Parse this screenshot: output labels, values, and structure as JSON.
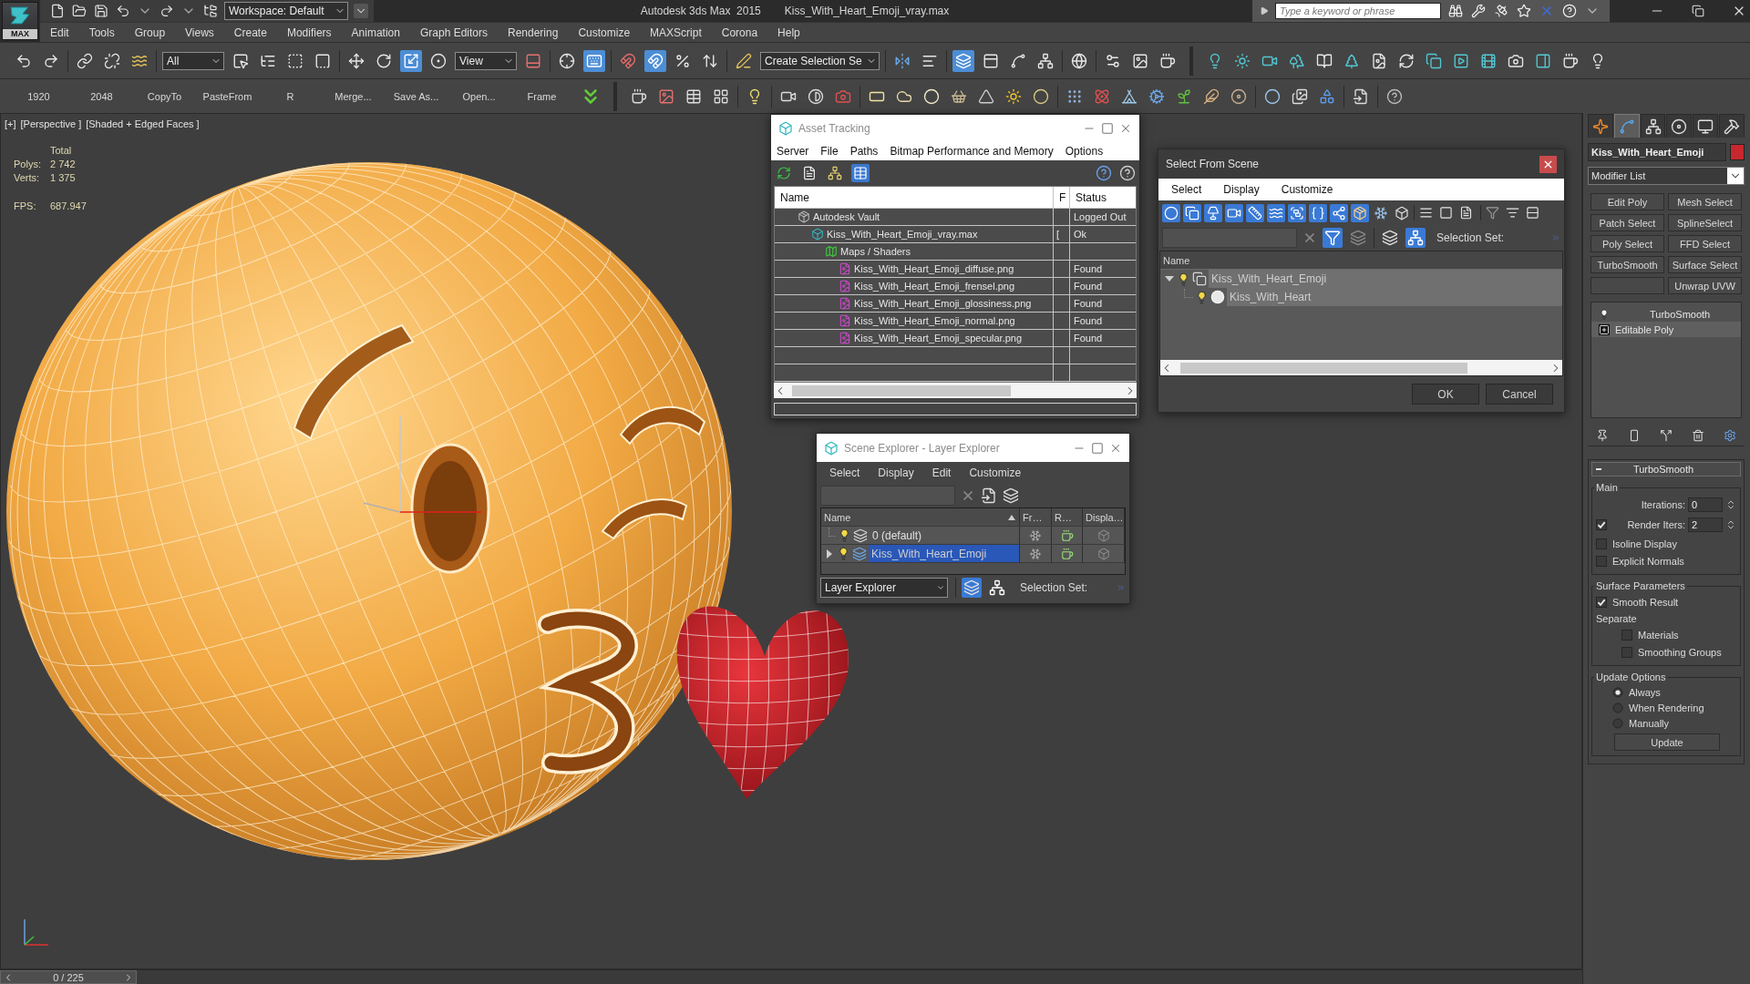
{
  "title_bar": {
    "app_button": "MAX",
    "workspace": "Workspace: Default",
    "app_name": "Autodesk 3ds Max  2015",
    "file_name": "Kiss_With_Heart_Emoji_vray.max",
    "search": {
      "placeholder": "Type a keyword or phrase"
    }
  },
  "menu_bar": [
    "Edit",
    "Tools",
    "Group",
    "Views",
    "Create",
    "Modifiers",
    "Animation",
    "Graph Editors",
    "Rendering",
    "Customize",
    "MAXScript",
    "Corona",
    "Help"
  ],
  "main_toolbar": {
    "groups": [
      [
        {
          "kind": "undo",
          "active": false
        },
        {
          "kind": "redo",
          "active": false
        }
      ],
      [
        {
          "kind": "link",
          "active": false
        },
        {
          "kind": "unlink",
          "active": false
        },
        {
          "kind": "bind",
          "active": false
        }
      ],
      [
        {
          "kind": "dropdown",
          "value": "All"
        },
        {
          "kind": "select",
          "active": false
        },
        {
          "kind": "select-by-name",
          "active": false
        },
        {
          "kind": "rect-region",
          "active": false
        },
        {
          "kind": "window-crossing",
          "active": false
        }
      ],
      [
        {
          "kind": "move",
          "active": false
        },
        {
          "kind": "rotate",
          "active": false
        },
        {
          "kind": "scale",
          "active": true
        },
        {
          "kind": "manipulate",
          "active": false
        },
        {
          "kind": "dropdown",
          "value": "View"
        },
        {
          "kind": "pivot",
          "active": false
        }
      ],
      [
        {
          "kind": "crosshair",
          "active": false
        },
        {
          "kind": "keyboard",
          "active": true
        }
      ],
      [
        {
          "kind": "snap",
          "active": false
        },
        {
          "kind": "angle-snap",
          "active": true
        },
        {
          "kind": "percent-snap",
          "active": false
        },
        {
          "kind": "spinner-snap",
          "active": false
        }
      ],
      [
        {
          "kind": "named-sel-edit",
          "active": false
        },
        {
          "kind": "dropdown",
          "value": "Create Selection Se"
        }
      ],
      [
        {
          "kind": "mirror",
          "active": false
        },
        {
          "kind": "align",
          "active": false
        }
      ],
      [
        {
          "kind": "layer-explorer",
          "active": true
        },
        {
          "kind": "ribbon",
          "active": false
        },
        {
          "kind": "curve-editor",
          "active": false
        },
        {
          "kind": "schematic",
          "active": false
        }
      ],
      [
        {
          "kind": "material-editor",
          "active": false
        }
      ],
      [
        {
          "kind": "render-setup",
          "active": false
        },
        {
          "kind": "render-frame",
          "active": false
        },
        {
          "kind": "render",
          "active": false
        }
      ]
    ]
  },
  "script_buttons": [
    "1920",
    "2048",
    "CopyTo",
    "PasteFrom",
    "R",
    "Merge...",
    "Save As...",
    "Open...",
    "Frame"
  ],
  "viewport": {
    "labels": [
      "[+]",
      "[Perspective ]",
      "[Shaded + Edged Faces ]"
    ],
    "stats": {
      "heading": "Total",
      "rows": [
        {
          "label": "Polys:",
          "value": "2 742"
        },
        {
          "label": "Verts:",
          "value": "1 375"
        }
      ]
    },
    "fps": {
      "label": "FPS:",
      "value": "687.947"
    }
  },
  "asset_tracking": {
    "title": "Asset Tracking",
    "menu": [
      "Server",
      "File",
      "Paths",
      "Bitmap Performance and Memory",
      "Options"
    ],
    "toolbar": [
      {
        "kind": "refresh",
        "active": false
      },
      {
        "kind": "list",
        "active": false
      },
      {
        "kind": "tree",
        "active": false
      },
      {
        "kind": "table",
        "active": true
      }
    ],
    "columns": [
      "Name",
      "F",
      "Status"
    ],
    "rows": [
      {
        "kind": "vault",
        "name": "Autodesk Vault",
        "status": "Logged Out",
        "children": [
          {
            "kind": "max-file",
            "name": "Kiss_With_Heart_Emoji_vray.max",
            "flag": "[",
            "status": "Ok",
            "children": [
              {
                "kind": "maps",
                "name": "Maps / Shaders",
                "children": [
                  {
                    "kind": "png",
                    "name": "Kiss_With_Heart_Emoji_diffuse.png",
                    "status": "Found"
                  },
                  {
                    "kind": "png",
                    "name": "Kiss_With_Heart_Emoji_frensel.png",
                    "status": "Found"
                  },
                  {
                    "kind": "png",
                    "name": "Kiss_With_Heart_Emoji_glossiness.png",
                    "status": "Found"
                  },
                  {
                    "kind": "png",
                    "name": "Kiss_With_Heart_Emoji_normal.png",
                    "status": "Found"
                  },
                  {
                    "kind": "png",
                    "name": "Kiss_With_Heart_Emoji_specular.png",
                    "status": "Found"
                  }
                ]
              }
            ]
          }
        ]
      }
    ]
  },
  "select_from_scene": {
    "title": "Select From Scene",
    "menu": [
      "Select",
      "Display",
      "Customize"
    ],
    "filters": [
      {
        "kind": "geometry",
        "active": true
      },
      {
        "kind": "shapes",
        "active": true
      },
      {
        "kind": "lights",
        "active": true
      },
      {
        "kind": "cameras",
        "active": true
      },
      {
        "kind": "helpers",
        "active": true
      },
      {
        "kind": "warps",
        "active": true
      },
      {
        "kind": "groups",
        "active": true
      },
      {
        "kind": "xrefs",
        "active": true
      },
      {
        "kind": "bones",
        "active": true
      },
      {
        "kind": "containers",
        "active": true
      },
      {
        "kind": "frozen",
        "active": false
      },
      {
        "kind": "hidden",
        "active": false
      }
    ],
    "search_tools": [
      {
        "kind": "find",
        "active": true
      },
      {
        "kind": "sync",
        "active": false
      }
    ],
    "view_modes": [
      {
        "kind": "layers",
        "active": false
      },
      {
        "kind": "hierarchy",
        "active": true
      }
    ],
    "selection_set_label": "Selection Set:",
    "column": "Name",
    "tree": [
      {
        "kind": "group",
        "name": "Kiss_With_Heart_Emoji",
        "selected": true,
        "expanded": true,
        "children": [
          {
            "kind": "geometry",
            "name": "Kiss_With_Heart",
            "selected": true
          }
        ]
      }
    ],
    "buttons": [
      "OK",
      "Cancel"
    ]
  },
  "scene_explorer": {
    "title": "Scene Explorer - Layer Explorer",
    "menu": [
      "Select",
      "Display",
      "Edit",
      "Customize"
    ],
    "columns": [
      "Name",
      "Fr…",
      "R…",
      "Displa…"
    ],
    "rows": [
      {
        "name": "0 (default)",
        "selected": false
      },
      {
        "name": "Kiss_With_Heart_Emoji",
        "selected": true,
        "expanded": false
      }
    ],
    "explorer": "Layer Explorer",
    "view_modes": [
      {
        "kind": "layers",
        "active": true
      },
      {
        "kind": "hierarchy",
        "active": false
      }
    ],
    "selection_set_label": "Selection Set:"
  },
  "command_panel": {
    "tabs": [
      {
        "kind": "create",
        "selected": false
      },
      {
        "kind": "modify",
        "selected": true
      },
      {
        "kind": "hierarchy",
        "selected": false
      },
      {
        "kind": "motion",
        "selected": false
      },
      {
        "kind": "display",
        "selected": false
      },
      {
        "kind": "utilities",
        "selected": false
      }
    ],
    "object_name": "Kiss_With_Heart_Emoji",
    "modifier_list": "Modifier List",
    "modifier_buttons": [
      {
        "kind": "modifier",
        "label": "Edit Poly"
      },
      {
        "kind": "modifier",
        "label": "Mesh Select"
      },
      {
        "kind": "modifier",
        "label": "Patch Select"
      },
      {
        "kind": "modifier",
        "label": "SplineSelect"
      },
      {
        "kind": "modifier",
        "label": "Poly Select"
      },
      {
        "kind": "modifier",
        "label": "FFD Select"
      },
      {
        "kind": "modifier",
        "label": "TurboSmooth"
      },
      {
        "kind": "modifier",
        "label": "Surface Select"
      },
      {
        "kind": "blank"
      },
      {
        "kind": "modifier",
        "label": "Unwrap UVW"
      }
    ],
    "stack": [
      {
        "name": "TurboSmooth",
        "on": true,
        "selected": false
      },
      {
        "name": "Editable Poly",
        "expanded": false,
        "selected": true
      }
    ],
    "rollout": {
      "title": "TurboSmooth",
      "expanded": true,
      "groups": [
        {
          "title": "Main",
          "controls": [
            {
              "kind": "spinner",
              "label": "Iterations:",
              "value": "0"
            },
            {
              "kind": "spinner",
              "label": "Render Iters:",
              "value": "2",
              "checked": true
            },
            {
              "kind": "checkbox",
              "label": "Isoline Display",
              "checked": false
            },
            {
              "kind": "checkbox",
              "label": "Explicit Normals",
              "checked": false
            }
          ]
        },
        {
          "title": "Surface Parameters",
          "controls": [
            {
              "kind": "checkbox",
              "label": "Smooth Result",
              "checked": true
            },
            {
              "kind": "label",
              "label": "Separate",
              "children": [
                {
                  "kind": "checkbox",
                  "label": "Materials",
                  "checked": false
                },
                {
                  "kind": "checkbox",
                  "label": "Smoothing Groups",
                  "checked": false
                }
              ]
            }
          ]
        },
        {
          "title": "Update Options",
          "controls": [
            {
              "kind": "radio",
              "label": "Always",
              "selected": true
            },
            {
              "kind": "radio",
              "label": "When Rendering",
              "selected": false
            },
            {
              "kind": "radio",
              "label": "Manually",
              "selected": false
            },
            {
              "kind": "button",
              "label": "Update"
            }
          ]
        }
      ]
    }
  },
  "time_slider": {
    "label": "0 / 225",
    "level": 0
  }
}
